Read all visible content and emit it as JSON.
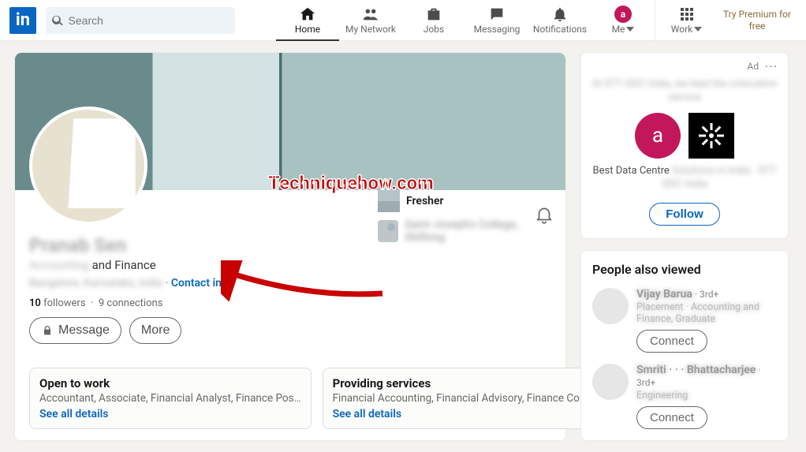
{
  "nav": {
    "search_placeholder": "Search",
    "home": "Home",
    "network": "My Network",
    "jobs": "Jobs",
    "messaging": "Messaging",
    "notifications": "Notifications",
    "me": "Me",
    "me_initial": "a",
    "work": "Work",
    "premium": "Try Premium for free"
  },
  "profile": {
    "name": "Pranab Sen",
    "headline": "Accounting and Finance",
    "location": "Bangalore, Karnataka, India",
    "contact_info": "Contact info",
    "followers_count": "10",
    "followers_label": "followers",
    "connections_count": "9",
    "connections_label": "connections",
    "message_btn": "Message",
    "more_btn": "More",
    "experience": [
      {
        "label": "Fresher"
      },
      {
        "label": "Saint Joseph's College, Shillong"
      }
    ]
  },
  "open_to_work": {
    "title": "Open to work",
    "desc": "Accountant, Associate, Financial Analyst, Finance Pos…",
    "see": "See all details"
  },
  "services": {
    "title": "Providing services",
    "desc": "Financial Accounting, Financial Advisory, Finance Co…",
    "see": "See all details"
  },
  "ad": {
    "label": "Ad",
    "tagline_top": "At STT GDC India, we lead the colocation service",
    "title": "Best Data Centre Solutions in India · STT GDC India",
    "avatar_initial": "a",
    "follow": "Follow"
  },
  "pav": {
    "title": "People also viewed",
    "people": [
      {
        "name": "Vijay Barua",
        "degree": " · 3rd+",
        "sub": "Placement · Accounting and Finance, Graduate",
        "btn": "Connect"
      },
      {
        "name": "Smriti · · · Bhattacharjee",
        "degree": " · 3rd+",
        "sub": "Engineering",
        "btn": "Connect"
      }
    ]
  },
  "watermark": "Techniquehow.com"
}
